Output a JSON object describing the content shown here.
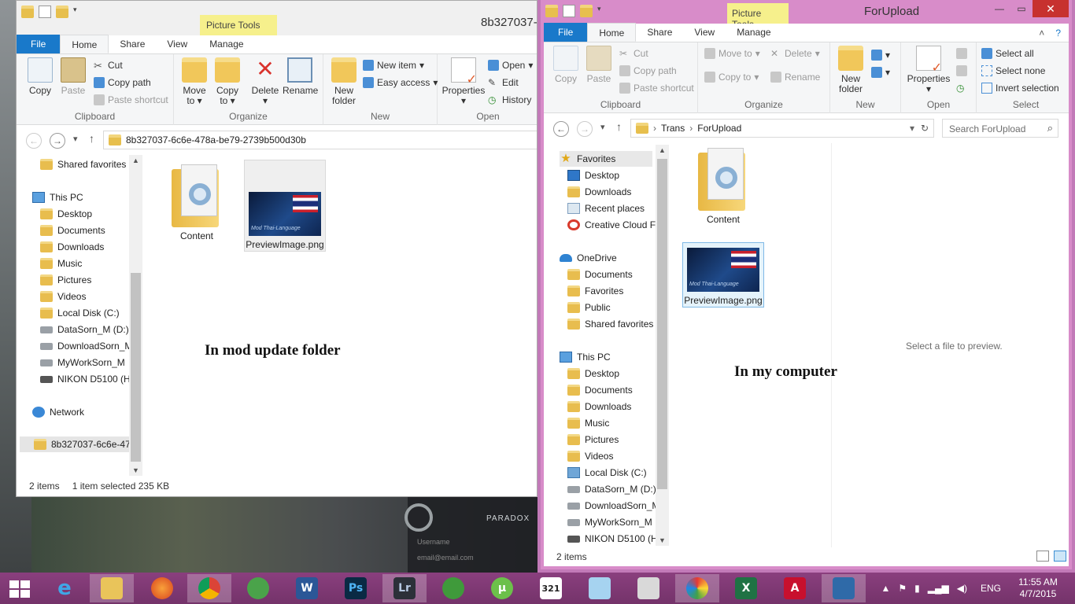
{
  "left_window": {
    "title": "8b327037-",
    "contextual_tab": "Picture Tools",
    "tabs": [
      "File",
      "Home",
      "Share",
      "View",
      "Manage"
    ],
    "ribbon": {
      "clipboard": {
        "copy": "Copy",
        "paste": "Paste",
        "cut": "Cut",
        "copy_path": "Copy path",
        "paste_shortcut": "Paste shortcut",
        "label": "Clipboard"
      },
      "organize": {
        "move_to": "Move",
        "move_to2": "to",
        "copy_to": "Copy",
        "copy_to2": "to",
        "delete": "Delete",
        "rename": "Rename",
        "label": "Organize"
      },
      "new": {
        "new_folder": "New",
        "new_folder2": "folder",
        "new_item": "New item",
        "easy_access": "Easy access",
        "label": "New"
      },
      "open": {
        "properties": "Properties",
        "open": "Open",
        "edit": "Edit",
        "history": "History",
        "label": "Open"
      }
    },
    "address": "8b327037-6c6e-478a-be79-2739b500d30b",
    "nav": {
      "shared_favorites": "Shared favorites",
      "this_pc": "This PC",
      "items": [
        "Desktop",
        "Documents",
        "Downloads",
        "Music",
        "Pictures",
        "Videos",
        "Local Disk (C:)",
        "DataSorn_M (D:)",
        "DownloadSorn_M",
        "MyWorkSorn_M",
        "NIKON D5100 (H"
      ],
      "network": "Network",
      "current_folder": "8b327037-6c6e-478"
    },
    "files": [
      {
        "name": "Content"
      },
      {
        "name": "PreviewImage.png",
        "thumb_caption": "Mod Thai-Language"
      }
    ],
    "note": "In mod update folder",
    "status": {
      "count": "2 items",
      "selection": "1 item selected  235 KB"
    }
  },
  "right_window": {
    "title": "ForUpload",
    "contextual_tab": "Picture Tools",
    "tabs": [
      "File",
      "Home",
      "Share",
      "View",
      "Manage"
    ],
    "ribbon": {
      "clipboard": {
        "copy": "Copy",
        "paste": "Paste",
        "cut": "Cut",
        "copy_path": "Copy path",
        "paste_shortcut": "Paste shortcut",
        "label": "Clipboard"
      },
      "organize": {
        "move_to": "Move to",
        "copy_to": "Copy to",
        "delete": "Delete",
        "rename": "Rename",
        "label": "Organize"
      },
      "new": {
        "new_folder": "New",
        "new_folder2": "folder",
        "label": "New"
      },
      "open": {
        "properties": "Properties",
        "label": "Open"
      },
      "select": {
        "select_all": "Select all",
        "select_none": "Select none",
        "invert": "Invert selection",
        "label": "Select"
      }
    },
    "breadcrumb": [
      "Trans",
      "ForUpload"
    ],
    "search_placeholder": "Search ForUpload",
    "nav": {
      "favorites": "Favorites",
      "fav_items": [
        "Desktop",
        "Downloads",
        "Recent places",
        "Creative Cloud F"
      ],
      "onedrive": "OneDrive",
      "onedrive_items": [
        "Documents",
        "Favorites",
        "Public",
        "Shared favorites"
      ],
      "this_pc": "This PC",
      "pc_items": [
        "Desktop",
        "Documents",
        "Downloads",
        "Music",
        "Pictures",
        "Videos",
        "Local Disk (C:)",
        "DataSorn_M (D:)",
        "DownloadSorn_M",
        "MyWorkSorn_M",
        "NIKON D5100 (H"
      ]
    },
    "files": [
      {
        "name": "Content"
      },
      {
        "name": "PreviewImage.png",
        "thumb_caption": "Mod Thai-Language"
      }
    ],
    "note": "In my computer",
    "preview_text": "Select a file to preview.",
    "status": {
      "count": "2 items"
    }
  },
  "background": {
    "brand": "PARADOX",
    "field1": "Username",
    "field2": "email@email.com"
  },
  "taskbar": {
    "apps": [
      "internet-explorer",
      "file-explorer",
      "firefox",
      "chrome",
      "globe-app",
      "word",
      "photoshop",
      "lightroom",
      "download-manager",
      "utorrent",
      "media-player-321",
      "notepad-app",
      "calculator",
      "paint",
      "excel",
      "autocad",
      "cities-app"
    ],
    "language": "ENG",
    "time": "11:55 AM",
    "date": "4/7/2015"
  }
}
